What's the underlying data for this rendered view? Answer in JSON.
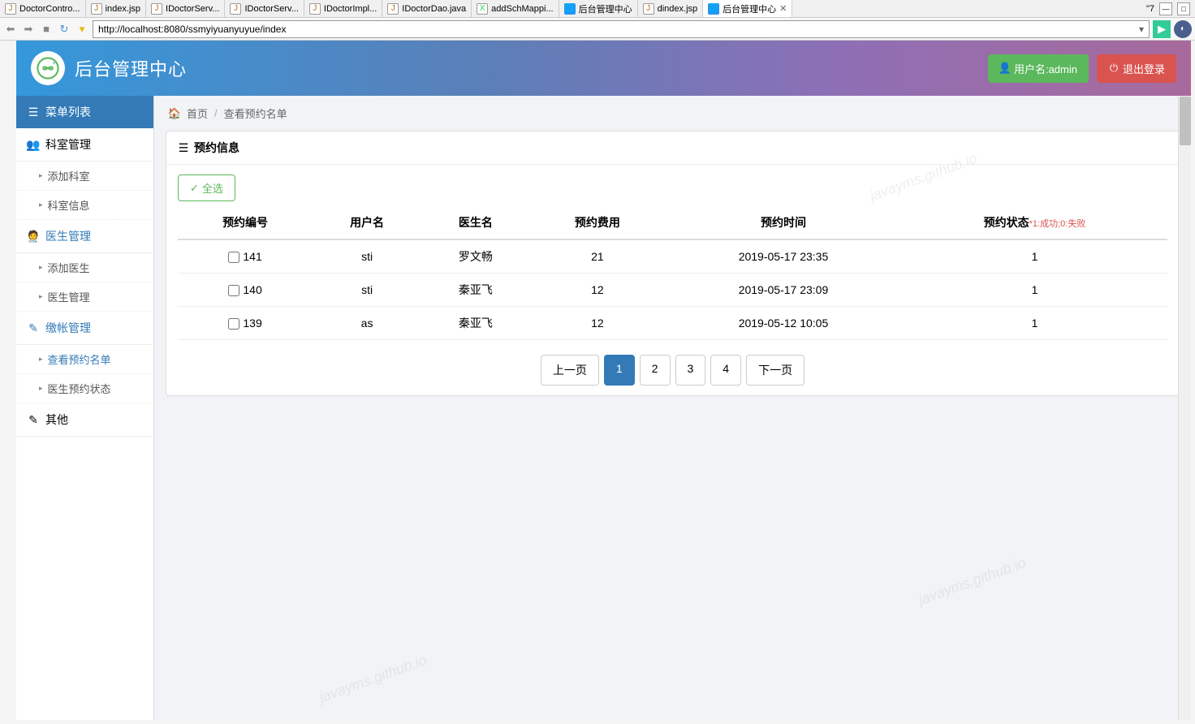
{
  "ide_tabs": [
    {
      "label": "DoctorContro...",
      "icon": "J"
    },
    {
      "label": "index.jsp",
      "icon": "J"
    },
    {
      "label": "IDoctorServ...",
      "icon": "J"
    },
    {
      "label": "IDoctorServ...",
      "icon": "J"
    },
    {
      "label": "IDoctorImpl...",
      "icon": "J"
    },
    {
      "label": "IDoctorDao.java",
      "icon": "J"
    },
    {
      "label": "addSchMappi...",
      "icon": "X"
    },
    {
      "label": "后台管理中心",
      "icon": "W"
    },
    {
      "label": "dindex.jsp",
      "icon": "J"
    },
    {
      "label": "后台管理中心",
      "icon": "W",
      "active": true,
      "closeable": true
    }
  ],
  "ide_right": {
    "label": "\"7"
  },
  "nav": {
    "url": "http://localhost:8080/ssmyiyuanyuyue/index"
  },
  "header": {
    "title": "后台管理中心",
    "user_btn": "用户名:admin",
    "logout_btn": "退出登录"
  },
  "sidebar": {
    "menu_header": "菜单列表",
    "sections": [
      {
        "title": "科室管理",
        "subs": [
          "添加科室",
          "科室信息"
        ]
      },
      {
        "title": "医生管理",
        "active": true,
        "subs": [
          "添加医生",
          "医生管理"
        ]
      },
      {
        "title": "缴帐管理",
        "active": true,
        "subs": [
          {
            "label": "查看预约名单",
            "active": true
          },
          {
            "label": "医生预约状态"
          }
        ]
      },
      {
        "title": "其他",
        "subs": []
      }
    ]
  },
  "breadcrumb": {
    "home": "首页",
    "current": "查看预约名单"
  },
  "panel": {
    "title": "预约信息",
    "select_all": "全选",
    "columns": [
      "预约编号",
      "用户名",
      "医生名",
      "预约费用",
      "预约时间",
      "预约状态"
    ],
    "status_note": "*1:成功;0:失败",
    "rows": [
      {
        "id": "141",
        "user": "sti",
        "doctor": "罗文畅",
        "fee": "21",
        "time": "2019-05-17 23:35",
        "status": "1"
      },
      {
        "id": "140",
        "user": "sti",
        "doctor": "秦亚飞",
        "fee": "12",
        "time": "2019-05-17 23:09",
        "status": "1"
      },
      {
        "id": "139",
        "user": "as",
        "doctor": "秦亚飞",
        "fee": "12",
        "time": "2019-05-12 10:05",
        "status": "1"
      }
    ]
  },
  "pager": {
    "prev": "上一页",
    "pages": [
      "1",
      "2",
      "3",
      "4"
    ],
    "active": 0,
    "next": "下一页"
  },
  "watermark": "javayms.github.io"
}
